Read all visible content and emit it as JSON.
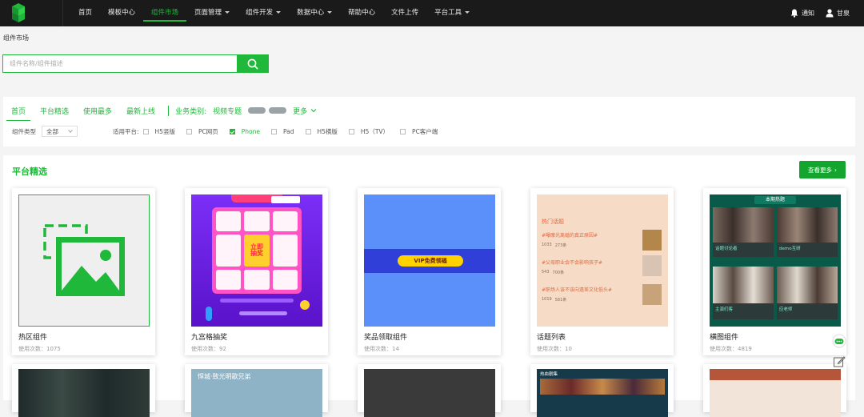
{
  "nav": {
    "items": [
      {
        "label": "首页"
      },
      {
        "label": "模板中心"
      },
      {
        "label": "组件市场",
        "active": true
      },
      {
        "label": "页面管理",
        "dropdown": true
      },
      {
        "label": "组件开发",
        "dropdown": true
      },
      {
        "label": "数据中心",
        "dropdown": true
      },
      {
        "label": "帮助中心"
      },
      {
        "label": "文件上传"
      },
      {
        "label": "平台工具",
        "dropdown": true
      }
    ],
    "notify_label": "通知",
    "user_label": "甘泉"
  },
  "breadcrumb": "组件市场",
  "search": {
    "placeholder": "组件名称/组件描述",
    "value": ""
  },
  "filter": {
    "tabs": [
      "首页",
      "平台精选",
      "使用最多",
      "最新上线"
    ],
    "biz_label": "业务类别:",
    "biz_item": "视频专题",
    "more_label": "更多",
    "type_label": "组件类型",
    "type_value": "全部",
    "platform_label": "适用平台:",
    "platforms": [
      {
        "label": "H5竖版",
        "checked": false
      },
      {
        "label": "PC网页",
        "checked": false
      },
      {
        "label": "Phone",
        "checked": true
      },
      {
        "label": "Pad",
        "checked": false
      },
      {
        "label": "H5横版",
        "checked": false
      },
      {
        "label": "H5（TV）",
        "checked": false
      },
      {
        "label": "PC客户端",
        "checked": false
      }
    ]
  },
  "section": {
    "title": "平台精选",
    "see_more": "查看更多"
  },
  "cards": [
    {
      "name": "热区组件",
      "usage": "使用次数：1075"
    },
    {
      "name": "九宫格抽奖",
      "usage": "使用次数：92"
    },
    {
      "name": "奖品领取组件",
      "usage": "使用次数：14"
    },
    {
      "name": "话题列表",
      "usage": "使用次数：10"
    },
    {
      "name": "横图组件",
      "usage": "使用次数：4819"
    }
  ],
  "thumbs": {
    "lottery_center": "立即\n抽奖",
    "vip_button": "VIP免费领福",
    "topic_header": "热门话题",
    "topics": [
      "#曝摩光离婚的真正原因#",
      "#父母职业会不会影响孩子#",
      "#职场人该不该向遗差文化低头#"
    ],
    "topic_stats": [
      [
        "1033",
        "273条"
      ],
      [
        "543",
        "700条"
      ],
      [
        "1019",
        "581条"
      ]
    ],
    "hot_header": "本期热题",
    "hot_caps": [
      "话题讨论者",
      "demo互研",
      "主演们客",
      "应老师"
    ],
    "row2_caption": "悍城·致光明歌兄弟",
    "row2_label": "热血剧集"
  },
  "colors": {
    "accent": "#1fb83a",
    "topbar": "#1a1a1a"
  }
}
